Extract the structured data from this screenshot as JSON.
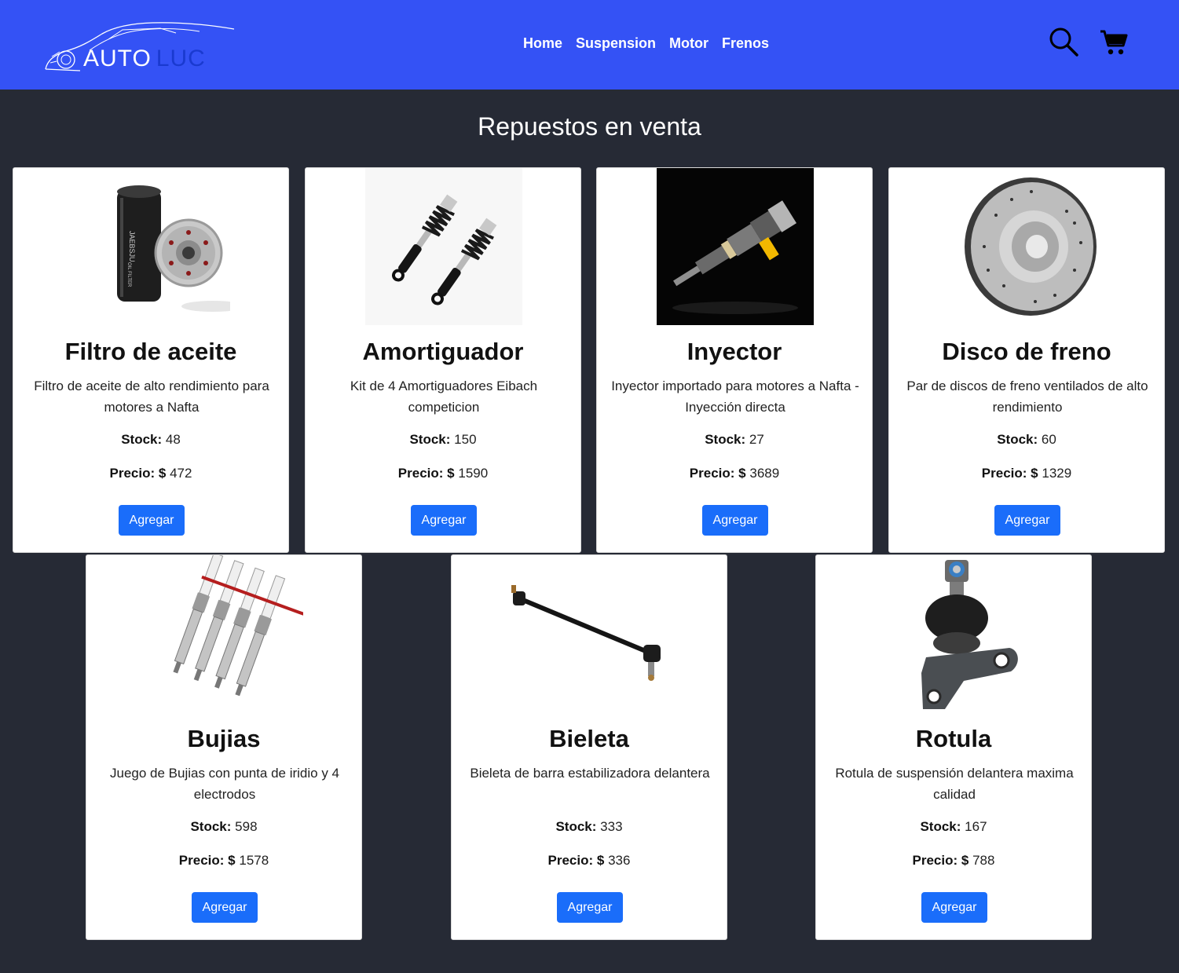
{
  "nav": {
    "logo": {
      "word1": "AUTO",
      "word2": "LUC"
    },
    "links": [
      "Home",
      "Suspension",
      "Motor",
      "Frenos"
    ],
    "icons": [
      "search-icon",
      "cart-icon"
    ],
    "color": "#3452f5"
  },
  "page": {
    "heading": "Repuestos en venta",
    "background": "#262a35"
  },
  "labels": {
    "stock": "Stock:",
    "price": "Precio:",
    "currency": "$",
    "button": "Agregar"
  },
  "products": [
    {
      "name": "Filtro de aceite",
      "description": "Filtro de aceite de alto rendimiento para motores a Nafta",
      "stock": "48",
      "price": "472"
    },
    {
      "name": "Amortiguador",
      "description": "Kit de 4 Amortiguadores Eibach competicion",
      "stock": "150",
      "price": "1590"
    },
    {
      "name": "Inyector",
      "description": "Inyector importado para motores a Nafta - Inyección directa",
      "stock": "27",
      "price": "3689"
    },
    {
      "name": "Disco de freno",
      "description": "Par de discos de freno ventilados de alto rendimiento",
      "stock": "60",
      "price": "1329"
    },
    {
      "name": "Bujias",
      "description": "Juego de Bujias con punta de iridio y 4 electrodos",
      "stock": "598",
      "price": "1578"
    },
    {
      "name": "Bieleta",
      "description": "Bieleta de barra estabilizadora delantera",
      "stock": "333",
      "price": "336"
    },
    {
      "name": "Rotula",
      "description": "Rotula de suspensión delantera maxima calidad",
      "stock": "167",
      "price": "788"
    }
  ]
}
